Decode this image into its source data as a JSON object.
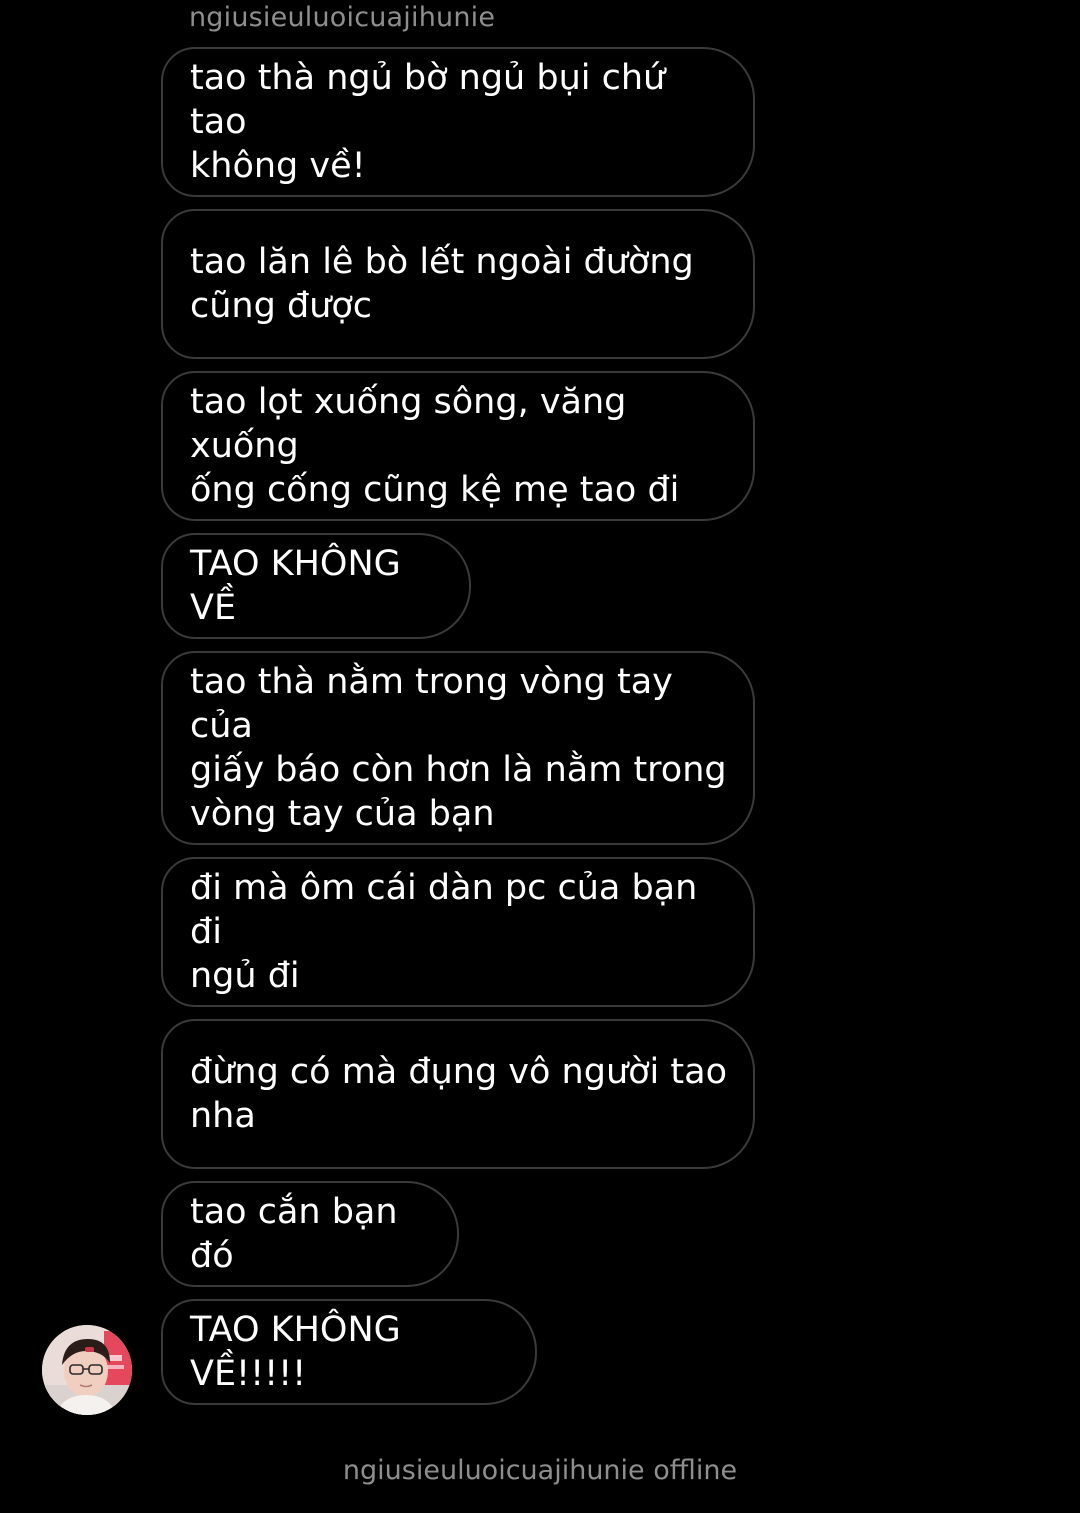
{
  "thread": {
    "sender_name": "ngiusieuluoicuajihunie",
    "messages": [
      {
        "text": "tao thà ngủ bờ ngủ bụi chứ tao\nkhông về!"
      },
      {
        "text": "tao lăn lê bò lết ngoài đường\ncũng được"
      },
      {
        "text": "tao lọt xuống sông, văng xuống\nống cống cũng kệ mẹ tao đi"
      },
      {
        "text": "TAO KHÔNG VỀ"
      },
      {
        "text": "tao thà nằm trong vòng tay của\ngiấy báo còn hơn là nằm trong\nvòng tay của bạn"
      },
      {
        "text": "đi mà ôm cái dàn pc của bạn đi\nngủ đi"
      },
      {
        "text": "đừng có mà đụng vô người tao\nnha"
      },
      {
        "text": "tao cắn bạn đó"
      },
      {
        "text": "TAO KHÔNG VỀ!!!!!"
      }
    ],
    "status_text": "ngiusieuluoicuajihunie offline"
  },
  "colors": {
    "background": "#000000",
    "bubble_border": "#3a3a3a",
    "message_text": "#ffffff",
    "meta_text": "#8e8e8e"
  }
}
